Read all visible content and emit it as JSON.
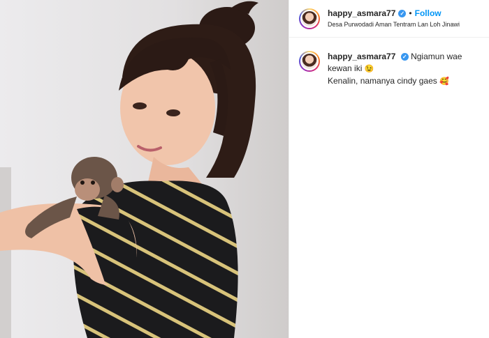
{
  "post": {
    "username": "happy_asmara77",
    "separator": "•",
    "follow_label": "Follow",
    "location": "Desa Purwodadi Aman Tentram Lan Loh Jinawi",
    "verified_glyph": "✓"
  },
  "caption": {
    "username": "happy_asmara77",
    "line1": "Ngiamun wae kewan iki",
    "line1_emoji": "😉",
    "line2": "Kenalin, namanya cindy gaes",
    "line2_emoji": "🥰"
  },
  "colors": {
    "accent_blue": "#0095f6",
    "verified_blue": "#3897f0",
    "text": "#262626",
    "divider": "#efefef"
  },
  "icons": {
    "verified": "verified-badge-icon",
    "avatar": "profile-avatar"
  }
}
